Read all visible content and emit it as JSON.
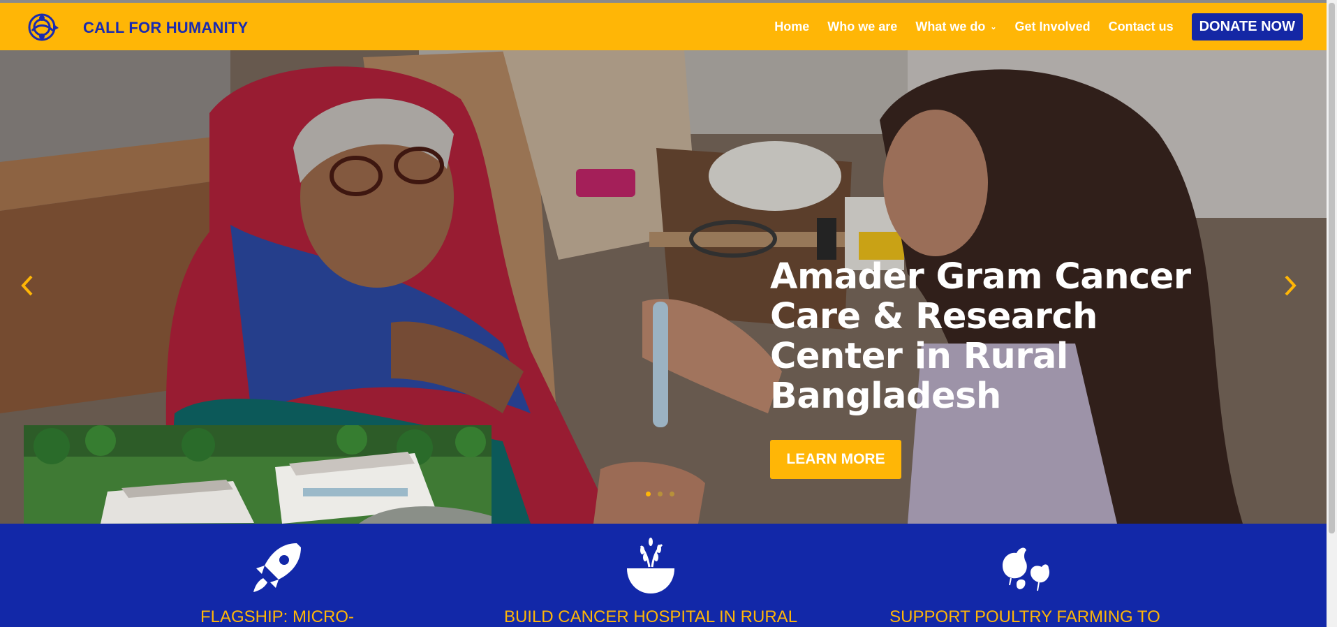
{
  "header": {
    "brand": "CALL FOR HUMANITY",
    "nav": [
      {
        "label": "Home"
      },
      {
        "label": "Who we are"
      },
      {
        "label": "What we do"
      },
      {
        "label": "Get Involved"
      },
      {
        "label": "Contact us"
      }
    ],
    "donate_label": "DONATE NOW"
  },
  "hero": {
    "title_lines": [
      "Amader Gram Cancer",
      "Care & Research",
      "Center in Rural",
      "Bangladesh"
    ],
    "cta_label": "LEARN MORE",
    "slide_count": 3,
    "active_slide": 1
  },
  "features": [
    {
      "title": "FLAGSHIP: MICRO-",
      "icon": "rocket-icon"
    },
    {
      "title": "BUILD CANCER HOSPITAL IN RURAL",
      "icon": "grain-bowl-icon"
    },
    {
      "title": "SUPPORT POULTRY FARMING TO",
      "icon": "chickens-icon"
    }
  ],
  "colors": {
    "header_bg": "#ffb606",
    "brand_blue": "#1a2bb0",
    "donate_bg": "#1427a5",
    "features_bg": "#1228a8",
    "accent": "#ffb606"
  }
}
